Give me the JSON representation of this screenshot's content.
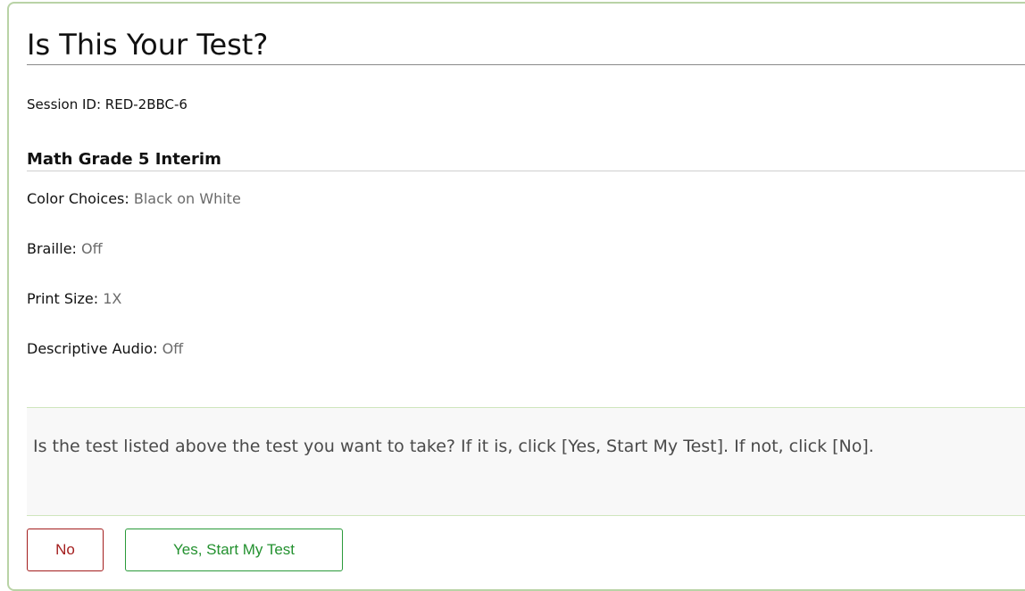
{
  "dialog": {
    "title": "Is This Your Test?",
    "session_id": "Session ID: RED-2BBC-6",
    "test_name": "Math Grade 5 Interim",
    "settings": [
      {
        "label": "Color Choices:",
        "value": "Black on White"
      },
      {
        "label": "Braille:",
        "value": "Off"
      },
      {
        "label": "Print Size:",
        "value": "1X"
      },
      {
        "label": "Descriptive Audio:",
        "value": "Off"
      }
    ],
    "prompt": "Is the test listed above the test you want to take? If it is, click [Yes, Start My Test]. If not, click [No].",
    "buttons": {
      "no_label": "No",
      "yes_label": "Yes, Start My Test"
    },
    "colors": {
      "panel_border": "#b9d3a6",
      "no_button": "#a31d1d",
      "yes_button": "#23912f",
      "setting_value": "#6b6b6b"
    }
  }
}
